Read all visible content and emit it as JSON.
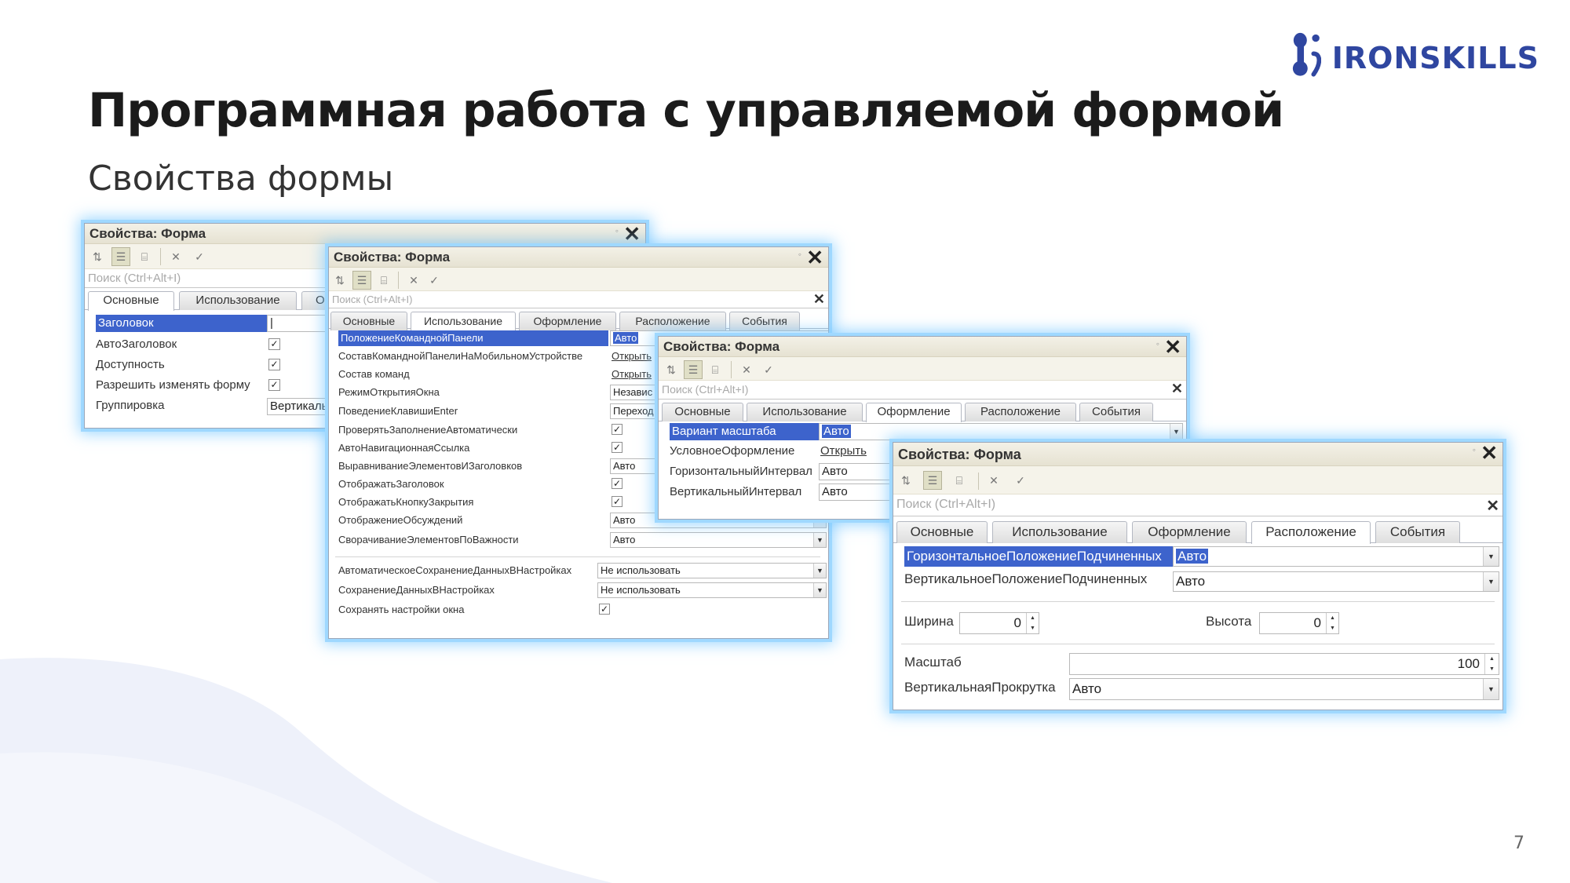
{
  "slide": {
    "title": "Программная работа с управляемой формой",
    "subtitle": "Свойства формы",
    "page_number": "7"
  },
  "logo": {
    "text": "IRONSKILLS",
    "color": "#2f46a0"
  },
  "toolbar_icons": [
    "sort-az-icon",
    "categories-icon",
    "filter-icon",
    "clear-icon",
    "check-icon"
  ],
  "win1": {
    "title": "Свойства: Форма",
    "search_placeholder": "Поиск (Ctrl+Alt+I)",
    "tabs": [
      "Основные",
      "Использование",
      "Оф"
    ],
    "rows": [
      {
        "label": "Заголовок",
        "value": "|"
      },
      {
        "label": "АвтоЗаголовок",
        "check": "✓"
      },
      {
        "label": "Доступность",
        "check": "✓"
      },
      {
        "label": "Разрешить изменять форму",
        "check": "✓"
      },
      {
        "label": "Группировка",
        "value": "Вертикаль"
      }
    ]
  },
  "win2": {
    "title": "Свойства: Форма",
    "search_placeholder": "Поиск (Ctrl+Alt+I)",
    "tabs": [
      "Основные",
      "Использование",
      "Оформление",
      "Расположение",
      "События"
    ],
    "rows": [
      {
        "label": "ПоложениеКоманднойПанели",
        "value": "Авто"
      },
      {
        "label": "СоставКоманднойПанелиНаМобильномУстройстве",
        "link": "Открыть"
      },
      {
        "label": "Состав команд",
        "link": "Открыть"
      },
      {
        "label": "РежимОткрытияОкна",
        "value": "Независ"
      },
      {
        "label": "ПоведениеКлавишиEnter",
        "value": "Переход"
      },
      {
        "label": "ПроверятьЗаполнениеАвтоматически",
        "check": "✓"
      },
      {
        "label": "АвтоНавигационнаяСсылка",
        "check": "✓"
      },
      {
        "label": "ВыравниваниеЭлементовИЗаголовков",
        "value": "Авто"
      },
      {
        "label": "ОтображатьЗаголовок",
        "check": "✓"
      },
      {
        "label": "ОтображатьКнопкуЗакрытия",
        "check": "✓"
      },
      {
        "label": "ОтображениеОбсуждений",
        "value": "Авто"
      },
      {
        "label": "СворачиваниеЭлементовПоВажности",
        "value": "Авто"
      },
      {
        "label": "АвтоматическоеСохранениеДанныхВНастройках",
        "value": "Не использовать"
      },
      {
        "label": "СохранениеДанныхВНастройках",
        "value": "Не использовать"
      },
      {
        "label": "Сохранять настройки окна",
        "check": "✓"
      }
    ]
  },
  "win3": {
    "title": "Свойства: Форма",
    "search_placeholder": "Поиск (Ctrl+Alt+I)",
    "tabs": [
      "Основные",
      "Использование",
      "Оформление",
      "Расположение",
      "События"
    ],
    "rows": [
      {
        "label": "Вариант масштаба",
        "value": "Авто"
      },
      {
        "label": "УсловноеОформление",
        "link": "Открыть"
      },
      {
        "label": "ГоризонтальныйИнтервал",
        "value": "Авто"
      },
      {
        "label": "ВертикальныйИнтервал",
        "value": "Авто"
      }
    ]
  },
  "win4": {
    "title": "Свойства: Форма",
    "search_placeholder": "Поиск (Ctrl+Alt+I)",
    "tabs": [
      "Основные",
      "Использование",
      "Оформление",
      "Расположение",
      "События"
    ],
    "rows": [
      {
        "label": "ГоризонтальноеПоложениеПодчиненных",
        "value": "Авто"
      },
      {
        "label": "ВертикальноеПоложениеПодчиненных",
        "value": "Авто"
      }
    ],
    "width_label": "Ширина",
    "width_value": "0",
    "height_label": "Высота",
    "height_value": "0",
    "scale_label": "Масштаб",
    "scale_value": "100",
    "vscroll_label": "ВертикальнаяПрокрутка",
    "vscroll_value": "Авто"
  }
}
